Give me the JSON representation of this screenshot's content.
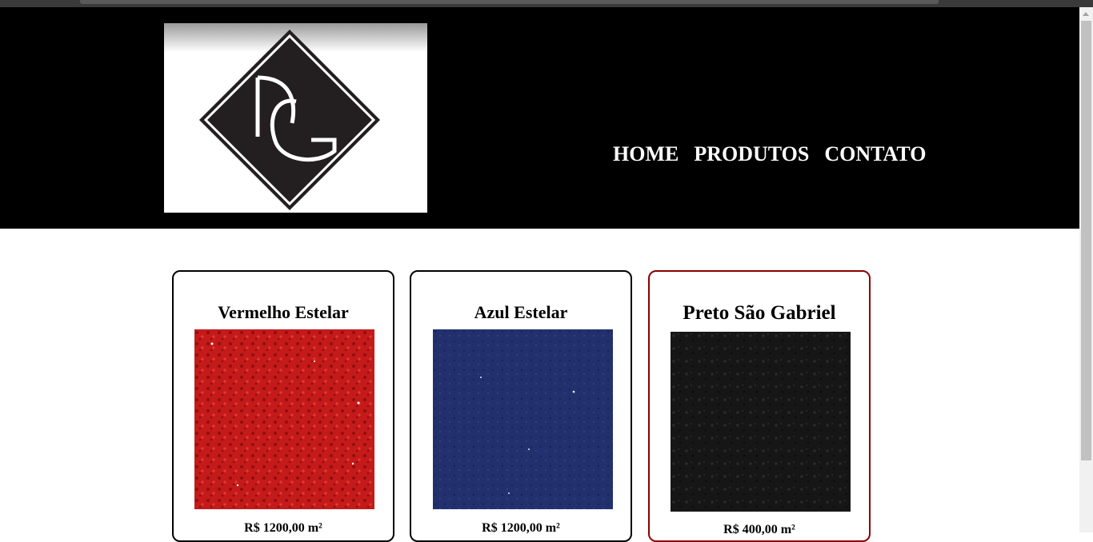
{
  "header": {
    "logo_text": "DG",
    "nav": [
      {
        "label": "HOME"
      },
      {
        "label": "PRODUTOS"
      },
      {
        "label": "CONTATO"
      }
    ]
  },
  "products": [
    {
      "name": "Vermelho Estelar",
      "price": "R$ 1200,00 m²",
      "color": "#c41a1a"
    },
    {
      "name": "Azul Estelar",
      "price": "R$ 1200,00 m²",
      "color": "#23306e"
    },
    {
      "name": "Preto São Gabriel",
      "price": "R$ 400,00 m²",
      "color": "#161616"
    }
  ],
  "colors": {
    "header_bg": "#000000",
    "active_card_border": "#8b0000"
  }
}
